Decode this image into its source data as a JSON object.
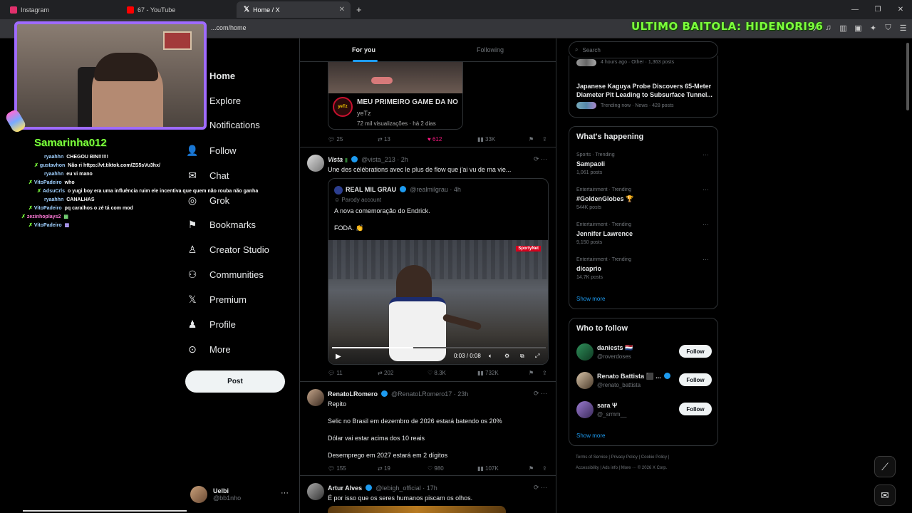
{
  "browser": {
    "tabs": [
      {
        "label": "Instagram",
        "color": "#e1306c"
      },
      {
        "label": "67 - YouTube",
        "color": "#ff0000"
      },
      {
        "label": "Home / X",
        "color": "#ffffff"
      }
    ],
    "url": "...com/home",
    "new_tab": "+",
    "win_minimize": "—",
    "win_restore": "❐",
    "win_close": "✕"
  },
  "stream": {
    "overlay_title": "ULTIMO BAITOLA: HIDENORI96",
    "streamer": "Samarinha012",
    "chat": [
      {
        "user": "ryaahhn",
        "text": "CHEGOU BIN!!!!!!"
      },
      {
        "user": "gustavhon",
        "text": "Não ri https://vt.tiktok.com/ZS5sVu3hx/"
      },
      {
        "user": "ryaahhn",
        "text": "eu vi mano"
      },
      {
        "user": "VitoPadeiro",
        "text": "who"
      },
      {
        "user": "AdsuCrls",
        "text": "o yugi boy era uma influência ruim ele incentiva que quem não rouba não ganha"
      },
      {
        "user": "ryaahhn",
        "text": "CANALHAS"
      },
      {
        "user": "VitoPadeiro",
        "text": "pq caralhos o zé tá com mod"
      },
      {
        "user": "zezinhoplays2",
        "text": ""
      },
      {
        "user": "VitoPadeiro",
        "text": ""
      }
    ]
  },
  "nav": {
    "items": [
      {
        "label": "Home",
        "icon": "home-icon"
      },
      {
        "label": "Explore",
        "icon": "search-icon"
      },
      {
        "label": "Notifications",
        "icon": "bell-icon"
      },
      {
        "label": "Follow",
        "icon": "follow-icon"
      },
      {
        "label": "Chat",
        "icon": "mail-icon"
      },
      {
        "label": "Grok",
        "icon": "grok-icon"
      },
      {
        "label": "Bookmarks",
        "icon": "bookmark-icon"
      },
      {
        "label": "Creator Studio",
        "icon": "creator-icon"
      },
      {
        "label": "Communities",
        "icon": "communities-icon"
      },
      {
        "label": "Premium",
        "icon": "x-icon"
      },
      {
        "label": "Profile",
        "icon": "profile-icon"
      },
      {
        "label": "More",
        "icon": "more-icon"
      }
    ],
    "post_label": "Post",
    "account": {
      "name": "Uelbi",
      "handle": "@bb1nho"
    }
  },
  "feed": {
    "tabs": [
      "For you",
      "Following"
    ],
    "tweets": [
      {
        "card_title": "MEU PRIMEIRO GAME DA NO",
        "card_channel": "yeTz",
        "card_stats": "72 mil visualizações · há 2 dias",
        "replies": "25",
        "retweets": "13",
        "likes": "612",
        "views": "33K"
      },
      {
        "name": "Vista",
        "handle": "@vista_213 · 2h",
        "text": "Une des célébrations avec le plus de flow que j'ai vu de ma vie...",
        "quote": {
          "name": "REAL MIL GRAU",
          "handle": "@realmilgrau · 4h",
          "label": "Parody account",
          "text1": "A nova comemoração do Endrick.",
          "text2": "FODA. 👏"
        },
        "video_badge": "SportyNet",
        "video_time": "0:03 / 0:08",
        "replies": "11",
        "retweets": "202",
        "likes": "8.3K",
        "views": "732K"
      },
      {
        "name": "RenatoLRomero",
        "handle": "@RenatoLRomero17 · 23h",
        "lines": [
          "Repito",
          "Selic  no Brasil em dezembro de 2026 estará batendo os 20%",
          "Dólar vai estar acima dos 10 reais",
          "Desemprego em 2027 estará em 2 dígitos"
        ],
        "replies": "155",
        "retweets": "19",
        "likes": "980",
        "views": "107K"
      },
      {
        "name": "Artur Alves",
        "handle": "@lebigh_official · 17h",
        "text": "É por isso que os seres humanos piscam os olhos."
      }
    ]
  },
  "right": {
    "search_placeholder": "Search",
    "news_top_meta": "4 hours ago · Other · 1,363 posts",
    "news_headline_1": "Japanese Kaguya Probe Discovers 65-Meter",
    "news_headline_2": "Diameter Pit Leading to Subsurface Tunnel...",
    "news_meta": "Trending now · News · 428 posts",
    "happening_title": "What's happening",
    "trends": [
      {
        "meta": "Sports · Trending",
        "name": "Sampaoli",
        "posts": "1,061 posts"
      },
      {
        "meta": "Entertainment · Trending",
        "name": "#GoldenGlobes 🏆",
        "posts": "544K posts"
      },
      {
        "meta": "Entertainment · Trending",
        "name": "Jennifer Lawrence",
        "posts": "9,150 posts"
      },
      {
        "meta": "Entertainment · Trending",
        "name": "dicaprio",
        "posts": "14.7K posts"
      }
    ],
    "show_more": "Show more",
    "wtf_title": "Who to follow",
    "follow_label": "Follow",
    "who_to_follow": [
      {
        "name": "daniests 🇳🇱",
        "handle": "@roverdoses"
      },
      {
        "name": "Renato Battista ⬛ ...",
        "handle": "@renato_battista"
      },
      {
        "name": "sara Ψ",
        "handle": "@_srmm__"
      }
    ],
    "footer_1": "Terms of Service  |  Privacy Policy  |  Cookie Policy  |",
    "footer_2": "Accessibility  |  Ads info  |  More ···  © 2026 X Corp."
  }
}
